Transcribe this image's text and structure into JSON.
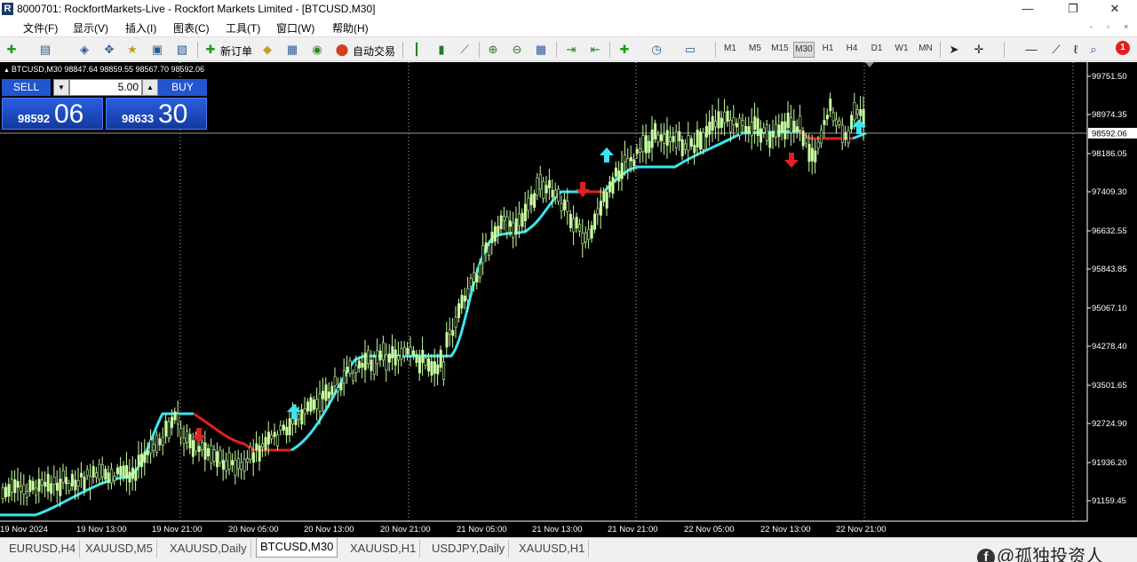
{
  "window": {
    "title": "8000701: RockfortMarkets-Live - Rockfort Markets Limited - [BTCUSD,M30]",
    "controls": [
      "—",
      "❐",
      "✕"
    ],
    "mdi_controls": [
      "-",
      "▫",
      "×"
    ]
  },
  "menu": [
    "文件(F)",
    "显示(V)",
    "插入(I)",
    "图表(C)",
    "工具(T)",
    "窗口(W)",
    "帮助(H)"
  ],
  "toolbar": {
    "new_order": "新订单",
    "auto_trading": "自动交易",
    "periods": [
      "M1",
      "M5",
      "M15",
      "M30",
      "H1",
      "H4",
      "D1",
      "W1",
      "MN"
    ],
    "active_period": "M30",
    "alert_count": "1"
  },
  "chart": {
    "header": "BTCUSD,M30  98847.64 98859.55 98567.70 98592.06",
    "current_price": "98592.06",
    "background": "#000000",
    "candle_color": "#c8ffa0",
    "trend_up_color": "#3de3f0",
    "trend_down_color": "#e02020"
  },
  "trade_panel": {
    "sell_label": "SELL",
    "buy_label": "BUY",
    "lot": "5.00",
    "sell_prefix": "98592",
    "sell_big": "06",
    "buy_prefix": "98633",
    "buy_big": "30"
  },
  "axes": {
    "y_labels": [
      "99751.50",
      "98974.35",
      "98186.05",
      "97409.30",
      "96632.55",
      "95843.85",
      "95067.10",
      "94278.40",
      "93501.65",
      "92724.90",
      "91936.20",
      "91159.45"
    ],
    "x_labels": [
      "19 Nov 2024",
      "19 Nov 13:00",
      "19 Nov 21:00",
      "20 Nov 05:00",
      "20 Nov 13:00",
      "20 Nov 21:00",
      "21 Nov 05:00",
      "21 Nov 13:00",
      "21 Nov 21:00",
      "22 Nov 05:00",
      "22 Nov 13:00",
      "22 Nov 21:00"
    ]
  },
  "tabs": [
    "EURUSD,H4",
    "XAUUSD,M5",
    "XAUUSD,Daily",
    "BTCUSD,M30",
    "XAUUSD,H1",
    "USDJPY,Daily",
    "XAUUSD,H1"
  ],
  "active_tab": "BTCUSD,M30",
  "watermark": "@孤独投资人"
}
